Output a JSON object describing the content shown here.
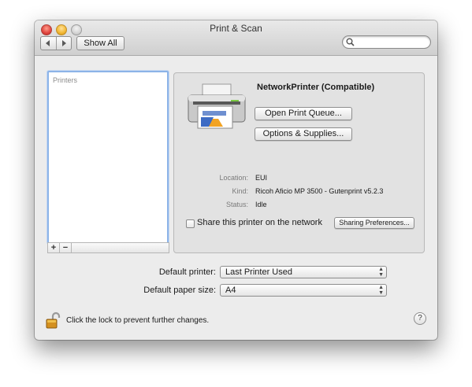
{
  "window": {
    "title": "Print & Scan"
  },
  "toolbar": {
    "back_icon": "chevron-left-icon",
    "forward_icon": "chevron-right-icon",
    "show_all_label": "Show All",
    "search_placeholder": ""
  },
  "printers_list": {
    "header": "Printers",
    "add_label": "+",
    "remove_label": "−"
  },
  "printer_detail": {
    "name": "NetworkPrinter (Compatible)",
    "open_queue_label": "Open Print Queue...",
    "options_label": "Options & Supplies...",
    "info": [
      {
        "label": "Location:",
        "value": "EUI"
      },
      {
        "label": "Kind:",
        "value": "Ricoh Aficio MP 3500 - Gutenprint v5.2.3"
      },
      {
        "label": "Status:",
        "value": "Idle"
      }
    ],
    "share_checkbox_label": "Share this printer on the network",
    "share_checked": false,
    "sharing_prefs_label": "Sharing Preferences..."
  },
  "defaults": {
    "printer_label": "Default printer:",
    "printer_value": "Last Printer Used",
    "paper_label": "Default paper size:",
    "paper_value": "A4"
  },
  "footer": {
    "lock_text": "Click the lock to prevent further changes.",
    "help_label": "?"
  }
}
